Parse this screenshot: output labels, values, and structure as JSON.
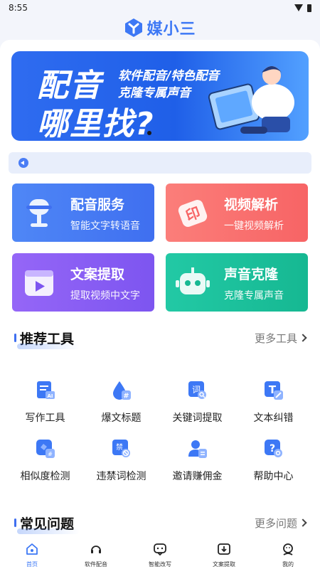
{
  "status": {
    "time": "8:55"
  },
  "app": {
    "name": "媒小三"
  },
  "banner": {
    "headline1": "配音",
    "headline2": "哪里找?",
    "line1": "软件配音/特色配音",
    "line2": "克隆专属声音"
  },
  "cards": [
    {
      "title": "配音服务",
      "subtitle": "智能文字转语音",
      "color": "#4f87f6",
      "icon": "microphone-icon"
    },
    {
      "title": "视频解析",
      "subtitle": "一键视频解析",
      "color": "#fb7e7a",
      "icon": "stamp-icon"
    },
    {
      "title": "文案提取",
      "subtitle": "提取视频中文字",
      "color": "#9566f7",
      "icon": "video-play-icon"
    },
    {
      "title": "声音克隆",
      "subtitle": "克隆专属声音",
      "color": "#22c9a5",
      "icon": "robot-icon"
    }
  ],
  "tools_section": {
    "title": "推荐工具",
    "more": "更多工具"
  },
  "tools": [
    {
      "label": "写作工具",
      "icon": "ai-document-icon"
    },
    {
      "label": "爆文标题",
      "icon": "hashtag-drop-icon"
    },
    {
      "label": "关键词提取",
      "icon": "keyword-search-icon"
    },
    {
      "label": "文本纠错",
      "icon": "text-edit-icon"
    },
    {
      "label": "相似度检测",
      "icon": "similarity-check-icon"
    },
    {
      "label": "违禁词检测",
      "icon": "forbidden-word-icon"
    },
    {
      "label": "邀请赚佣金",
      "icon": "invite-commission-icon"
    },
    {
      "label": "帮助中心",
      "icon": "help-center-icon"
    }
  ],
  "faq_section": {
    "title": "常见问题",
    "more": "更多问题"
  },
  "tabbar": [
    {
      "label": "首页",
      "icon": "home-icon",
      "active": true
    },
    {
      "label": "软件配音",
      "icon": "headset-icon",
      "active": false
    },
    {
      "label": "智能改写",
      "icon": "chat-bubble-icon",
      "active": false
    },
    {
      "label": "文案提取",
      "icon": "download-box-icon",
      "active": false
    },
    {
      "label": "我的",
      "icon": "user-icon",
      "active": false
    }
  ],
  "colors": {
    "accent": "#3d78f5"
  }
}
